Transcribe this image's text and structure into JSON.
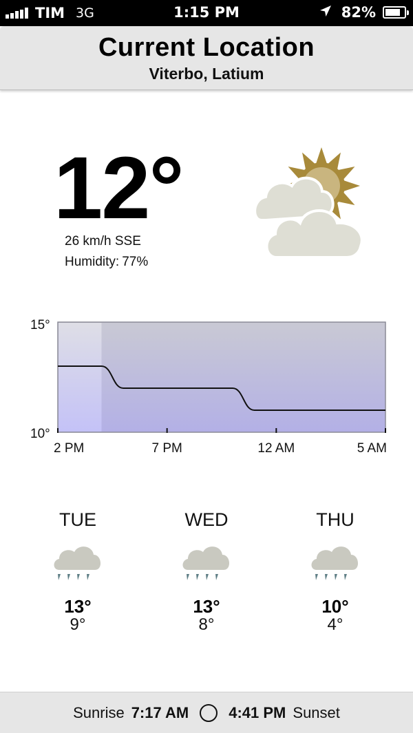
{
  "status_bar": {
    "carrier": "TIM",
    "network": "3G",
    "time": "1:15 PM",
    "battery_percent": "82%",
    "battery_level": 0.82,
    "icons": [
      "signal-bars-icon",
      "location-arrow-icon",
      "battery-icon"
    ]
  },
  "header": {
    "title": "Current Location",
    "subtitle": "Viterbo, Latium"
  },
  "current": {
    "temperature": "12°",
    "wind": "26 km/h SSE",
    "humidity_label": "Humidity:",
    "humidity_value": "77%",
    "condition_icon": "partly-cloudy-icon"
  },
  "chart_data": {
    "type": "line",
    "x_tick_labels": [
      "2 PM",
      "7 PM",
      "12 AM",
      "5 AM"
    ],
    "y_tick_labels": [
      "15°",
      "10°"
    ],
    "ylim": [
      10,
      15
    ],
    "x": [
      14,
      15,
      16,
      17,
      18,
      19,
      20,
      21,
      22,
      23,
      24,
      25,
      26,
      27,
      28,
      29
    ],
    "values": [
      13,
      13,
      13,
      12,
      12,
      12,
      12,
      12,
      12,
      11,
      11,
      11,
      11,
      11,
      11,
      11
    ],
    "highlight_range_hours": [
      14,
      16
    ]
  },
  "forecast": [
    {
      "day": "TUE",
      "high": "13°",
      "low": "9°",
      "icon": "rain-icon"
    },
    {
      "day": "WED",
      "high": "13°",
      "low": "8°",
      "icon": "rain-icon"
    },
    {
      "day": "THU",
      "high": "10°",
      "low": "4°",
      "icon": "rain-icon"
    }
  ],
  "sun": {
    "sunrise_label": "Sunrise",
    "sunrise_time": "7:17 AM",
    "sunset_time": "4:41 PM",
    "sunset_label": "Sunset"
  },
  "colors": {
    "sun_accent": "#a88a3a",
    "cloud": "#deded4",
    "rain_drop": "#5f7f86",
    "chart_fill_top": "#c9c9d4",
    "chart_fill_bottom": "#b3b0e6"
  }
}
